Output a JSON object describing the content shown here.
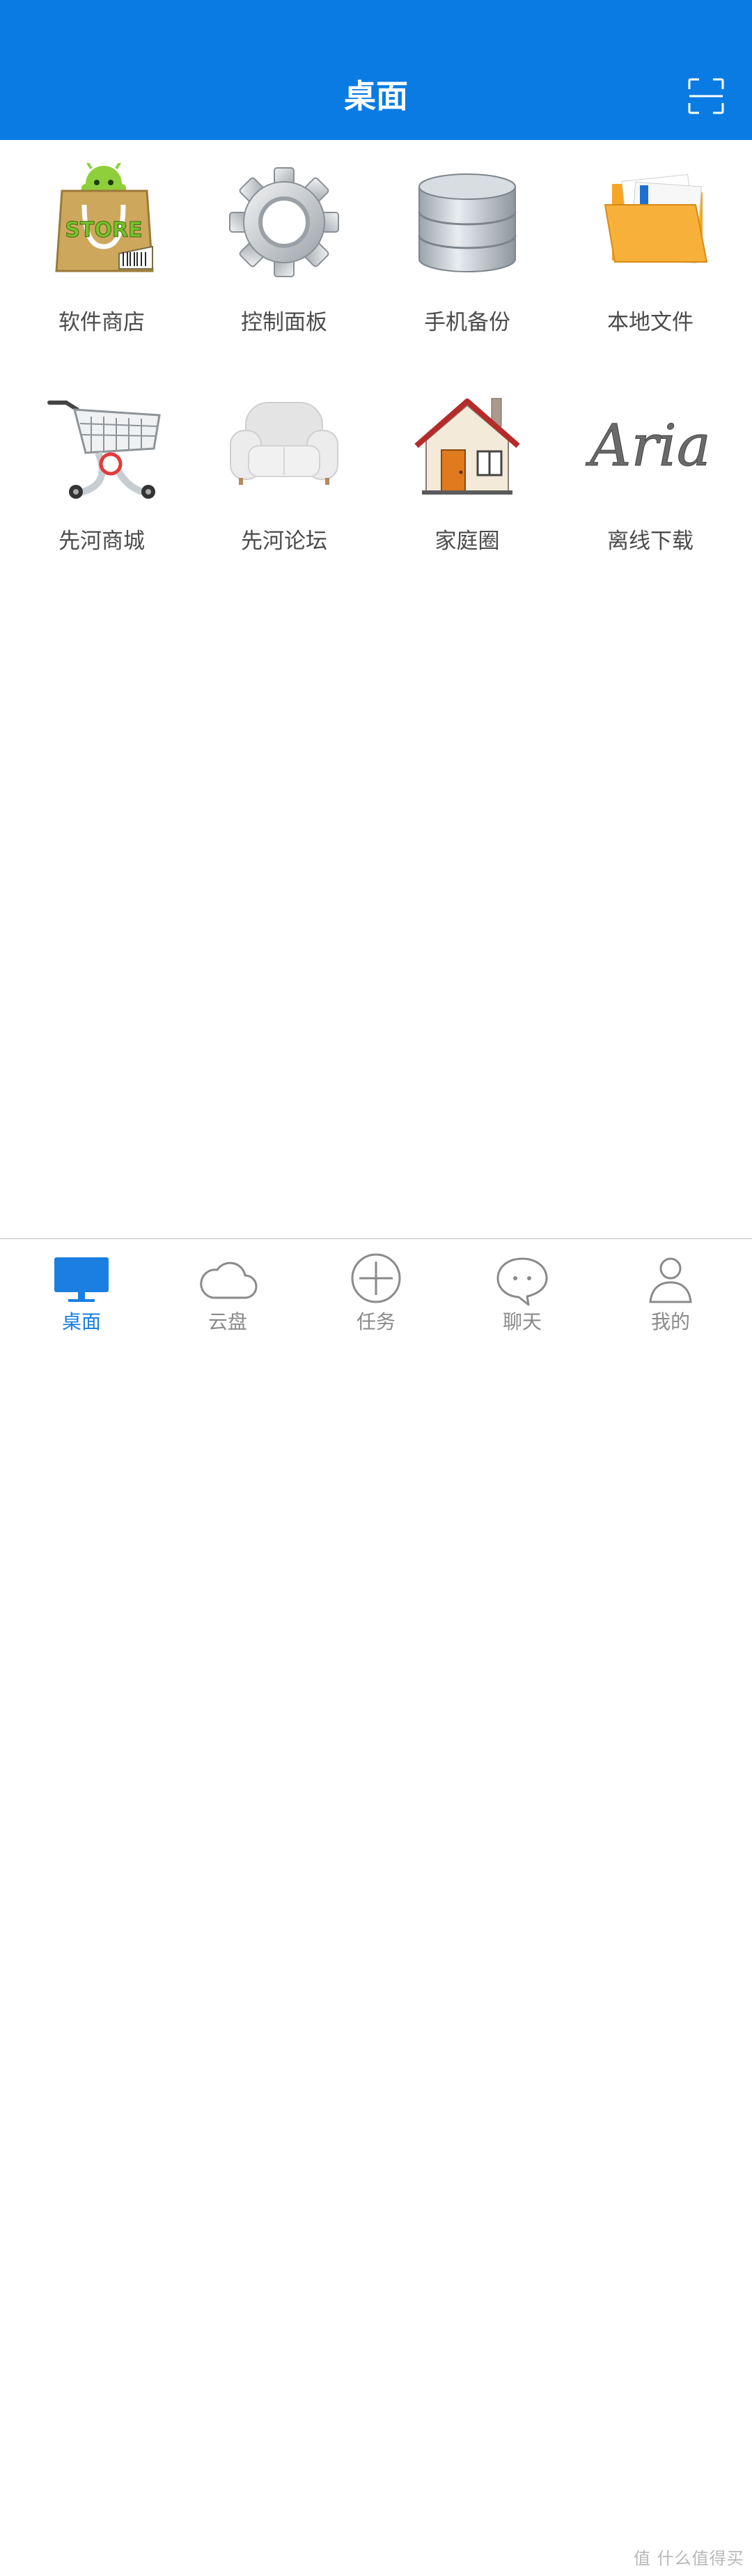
{
  "header": {
    "title": "桌面",
    "scan_icon": "scan-icon"
  },
  "apps": [
    {
      "label": "软件商店",
      "icon": "store-bag-icon"
    },
    {
      "label": "控制面板",
      "icon": "gear-icon"
    },
    {
      "label": "手机备份",
      "icon": "database-icon"
    },
    {
      "label": "本地文件",
      "icon": "folder-icon"
    },
    {
      "label": "先河商城",
      "icon": "shopping-cart-icon"
    },
    {
      "label": "先河论坛",
      "icon": "sofa-icon"
    },
    {
      "label": "家庭圈",
      "icon": "house-icon"
    },
    {
      "label": "离线下载",
      "icon": "aria-logo-icon",
      "logo_text": "Aria"
    }
  ],
  "tabs": [
    {
      "label": "桌面",
      "icon": "desktop-icon",
      "active": true
    },
    {
      "label": "云盘",
      "icon": "cloud-icon",
      "active": false
    },
    {
      "label": "任务",
      "icon": "plus-circle-icon",
      "active": false
    },
    {
      "label": "聊天",
      "icon": "chat-bubble-icon",
      "active": false
    },
    {
      "label": "我的",
      "icon": "user-icon",
      "active": false
    }
  ],
  "watermark": "值 什么值得买",
  "colors": {
    "primary": "#0a7be2",
    "active_tab": "#1a7fe0",
    "inactive_tab": "#8a8a8a",
    "label": "#4b4b4b"
  }
}
